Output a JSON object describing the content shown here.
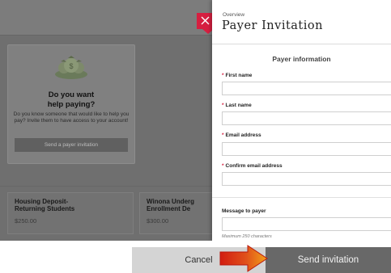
{
  "background": {
    "help_card": {
      "title_line1": "Do you want",
      "title_line2": "help paying?",
      "body": "Do you know someone that would like to help you pay? Invite them to have access to your account!",
      "button_label": "Send a payer invitation"
    },
    "items": [
      {
        "title_line1": "Housing Deposit-",
        "title_line2": "Returning Students",
        "price": "$250.00"
      },
      {
        "title_line1": "Winona Underg",
        "title_line2": "Enrollment De",
        "price": "$300.00"
      }
    ]
  },
  "modal": {
    "overview_label": "Overview",
    "title": "Payer Invitation",
    "section_heading": "Payer information",
    "required_mark": "*",
    "fields": {
      "first_name": {
        "label": "First name",
        "value": ""
      },
      "last_name": {
        "label": "Last name",
        "value": ""
      },
      "email": {
        "label": "Email address",
        "value": ""
      },
      "confirm_email": {
        "label": "Confirm email address",
        "value": ""
      },
      "message": {
        "label": "Message to payer",
        "value": "",
        "hint": "Maximum 250 characters"
      }
    }
  },
  "footer": {
    "cancel_label": "Cancel",
    "send_label": "Send invitation"
  },
  "colors": {
    "accent_red": "#d61f40",
    "arrow_red": "#d21d10",
    "arrow_orange": "#f3a21a"
  }
}
